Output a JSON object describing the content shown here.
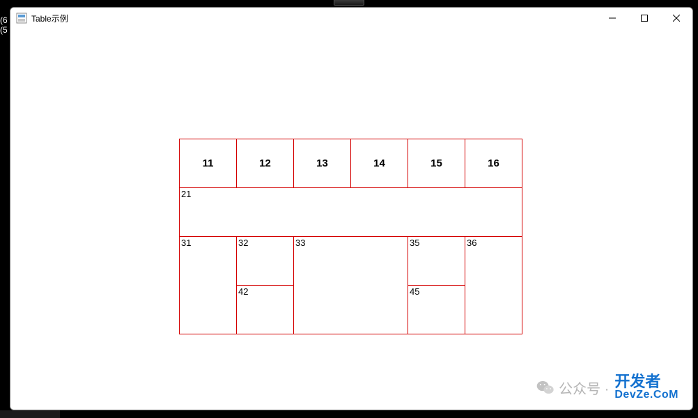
{
  "behind": {
    "line1": "(6",
    "line2": "(5"
  },
  "window": {
    "title": "Table示例"
  },
  "table": {
    "row1": [
      "11",
      "12",
      "13",
      "14",
      "15",
      "16"
    ],
    "row2": {
      "c1": "21"
    },
    "row3": {
      "c1": "31",
      "c2": "32",
      "c3": "33",
      "c5": "35",
      "c6": "36"
    },
    "row4": {
      "c2": "42",
      "c5": "45"
    }
  },
  "watermark": {
    "left": "公众号 · ",
    "right1": "开发者",
    "right2": "DevZe.CoM"
  }
}
